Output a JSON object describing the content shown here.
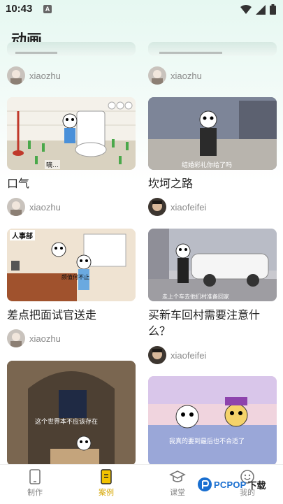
{
  "status_bar": {
    "time": "10:43",
    "notification_glyph": "A"
  },
  "page": {
    "title": "动画"
  },
  "cards": [
    {
      "title": "",
      "author": "xiaozhu"
    },
    {
      "title": "",
      "author": "xiaozhu"
    },
    {
      "title": "口气",
      "author": "xiaozhu",
      "caption": "嘀…"
    },
    {
      "title": "坎坷之路",
      "author": "xiaofeifei",
      "caption": "结婚彩礼你给了吗"
    },
    {
      "title": "差点把面试官送走",
      "author": "xiaozhu",
      "sign": "人事部",
      "caption": "颜值何不止"
    },
    {
      "title": "买新车回村需要注意什么？",
      "author": "xiaofeifei",
      "caption": "走上个车去他们村准备回家"
    },
    {
      "title": "",
      "author": "",
      "caption": "这个世界本不应该存在"
    },
    {
      "title": "",
      "author": "",
      "caption": "我真的要到最后也不合适了"
    }
  ],
  "tabs": [
    {
      "label": "制作",
      "icon": "phone-icon"
    },
    {
      "label": "案例",
      "icon": "case-book-icon",
      "active": true
    },
    {
      "label": "课堂",
      "icon": "graduation-cap-icon"
    },
    {
      "label": "我的",
      "icon": "smile-face-icon"
    }
  ],
  "watermark": {
    "brand": "PCPOP",
    "suffix": "下载"
  },
  "colors": {
    "accent": "#d6a600",
    "background_tint": "#e6f8f1",
    "text": "#222222",
    "muted": "#8a8a8a"
  }
}
